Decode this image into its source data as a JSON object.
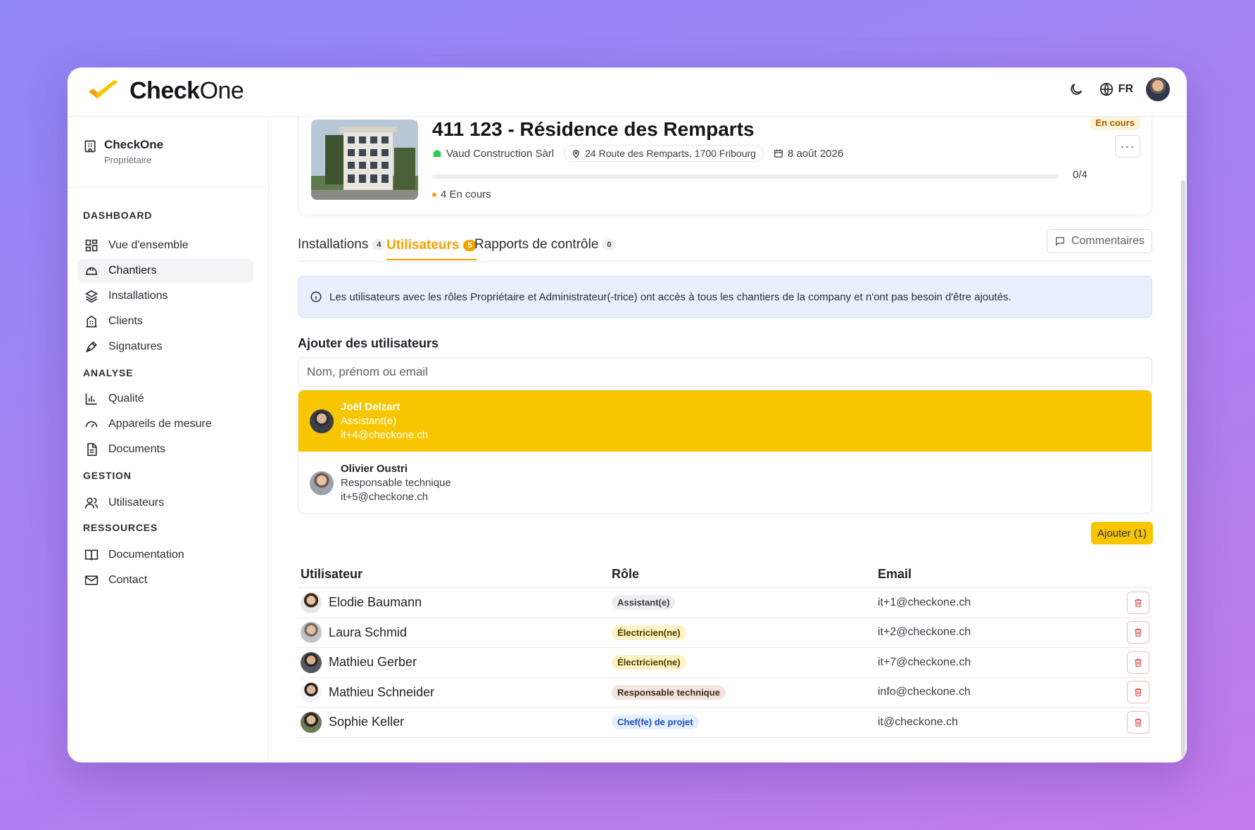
{
  "app": {
    "logo_bold": "Check",
    "logo_light": "One",
    "language": "FR"
  },
  "colors": {
    "accent": "#f7c600",
    "tab_active": "#f5a200",
    "danger": "#e05252",
    "info_bg": "#e8f0fd"
  },
  "sidebar": {
    "org_name": "CheckOne",
    "org_role": "Propriétaire",
    "sections": {
      "dashboard": "DASHBOARD",
      "analyse": "ANALYSE",
      "gestion": "GESTION",
      "ressources": "RESSOURCES"
    },
    "items": [
      {
        "label": "Vue d'ensemble",
        "icon": "grid-icon"
      },
      {
        "label": "Chantiers",
        "icon": "helmet-icon",
        "active": true
      },
      {
        "label": "Installations",
        "icon": "layers-icon"
      },
      {
        "label": "Clients",
        "icon": "building-icon"
      },
      {
        "label": "Signatures",
        "icon": "pen-icon"
      },
      {
        "label": "Qualité",
        "icon": "bar-chart-icon"
      },
      {
        "label": "Appareils de mesure",
        "icon": "gauge-icon"
      },
      {
        "label": "Documents",
        "icon": "document-icon"
      },
      {
        "label": "Utilisateurs",
        "icon": "users-icon"
      },
      {
        "label": "Documentation",
        "icon": "book-icon"
      },
      {
        "label": "Contact",
        "icon": "mail-icon"
      }
    ]
  },
  "project": {
    "title": "411 123 - Résidence des Remparts",
    "company": "Vaud Construction Sàrl",
    "address": "24 Route des Remparts, 1700 Fribourg",
    "date": "8 août 2026",
    "progress_label": "0/4",
    "progress_fraction": 0,
    "status_count": "4 En cours",
    "status_badge": "En cours"
  },
  "tabs": [
    {
      "label": "Installations",
      "count": "4"
    },
    {
      "label": "Utilisateurs",
      "count": "5",
      "active": true
    },
    {
      "label": "Rapports de contrôle",
      "count": "0"
    }
  ],
  "comments_label": "Commentaires",
  "info_text": "Les utilisateurs avec les rôles Propriétaire et Administrateur(-trice) ont accès à tous les chantiers de la company et n'ont pas besoin d'être ajoutés.",
  "add_users": {
    "title": "Ajouter des utilisateurs",
    "placeholder": "Nom, prénom ou email",
    "results": [
      {
        "name": "Joël Delzart",
        "role": "Assistant(e)",
        "email": "it+4@checkone.ch",
        "selected": true
      },
      {
        "name": "Olivier Oustri",
        "role": "Responsable technique",
        "email": "it+5@checkone.ch",
        "selected": false
      }
    ],
    "add_button": "Ajouter (1)"
  },
  "table": {
    "headers": {
      "user": "Utilisateur",
      "role": "Rôle",
      "email": "Email"
    },
    "rows": [
      {
        "name": "Elodie Baumann",
        "role": "Assistant(e)",
        "role_color": "#eeeef1",
        "role_text": "#3a3d45",
        "email": "it+1@checkone.ch"
      },
      {
        "name": "Laura Schmid",
        "role": "Électricien(ne)",
        "role_color": "#fdf3c4",
        "role_text": "#4a3b00",
        "email": "it+2@checkone.ch"
      },
      {
        "name": "Mathieu Gerber",
        "role": "Électricien(ne)",
        "role_color": "#fdf3c4",
        "role_text": "#4a3b00",
        "email": "it+7@checkone.ch"
      },
      {
        "name": "Mathieu Schneider",
        "role": "Responsable technique",
        "role_color": "#f3e4dc",
        "role_text": "#3a2a22",
        "email": "info@checkone.ch"
      },
      {
        "name": "Sophie Keller",
        "role": "Chef(fe) de projet",
        "role_color": "#e6efff",
        "role_text": "#1d4fb8",
        "email": "it@checkone.ch"
      }
    ]
  }
}
